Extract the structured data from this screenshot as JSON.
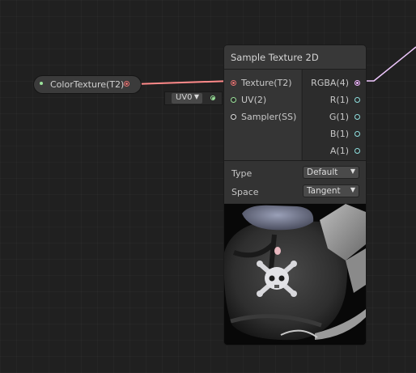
{
  "property_node": {
    "label": "ColorTexture(T2)"
  },
  "uv_input": {
    "selected": "UV0"
  },
  "sample_node": {
    "title": "Sample Texture 2D",
    "inputs": [
      {
        "label": "Texture(T2)",
        "port_color": "#e57373"
      },
      {
        "label": "UV(2)",
        "port_color": "#9be39b"
      },
      {
        "label": "Sampler(SS)",
        "port_color": "#dddddd"
      }
    ],
    "outputs": [
      {
        "label": "RGBA(4)",
        "port_color": "#f0b4ff"
      },
      {
        "label": "R(1)",
        "port_color": "#8fe0e0"
      },
      {
        "label": "G(1)",
        "port_color": "#8fe0e0"
      },
      {
        "label": "B(1)",
        "port_color": "#8fe0e0"
      },
      {
        "label": "A(1)",
        "port_color": "#8fe0e0"
      }
    ],
    "settings": {
      "type_label": "Type",
      "type_value": "Default",
      "space_label": "Space",
      "space_value": "Tangent"
    }
  },
  "colors": {
    "edge_texture": "#ff8a8a",
    "edge_rgba": "#f0c8ff",
    "edge_uv": "#9be39b"
  }
}
